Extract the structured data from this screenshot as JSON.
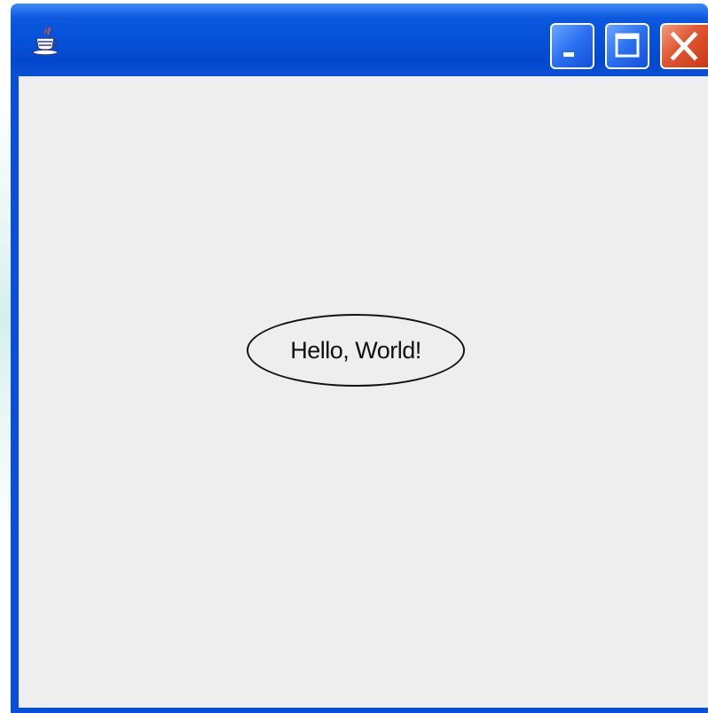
{
  "desktop": {
    "background_color": "#ffffff"
  },
  "window": {
    "title": "",
    "app_icon": "java-coffee-cup-icon",
    "controls": {
      "minimize": "minimize-icon",
      "maximize": "maximize-icon",
      "close": "close-icon"
    },
    "colors": {
      "titlebar": "#0450d6",
      "close_button": "#e1552e",
      "client_background": "#eeeeee"
    }
  },
  "canvas": {
    "shape": "ellipse",
    "label": "Hello, World!"
  }
}
